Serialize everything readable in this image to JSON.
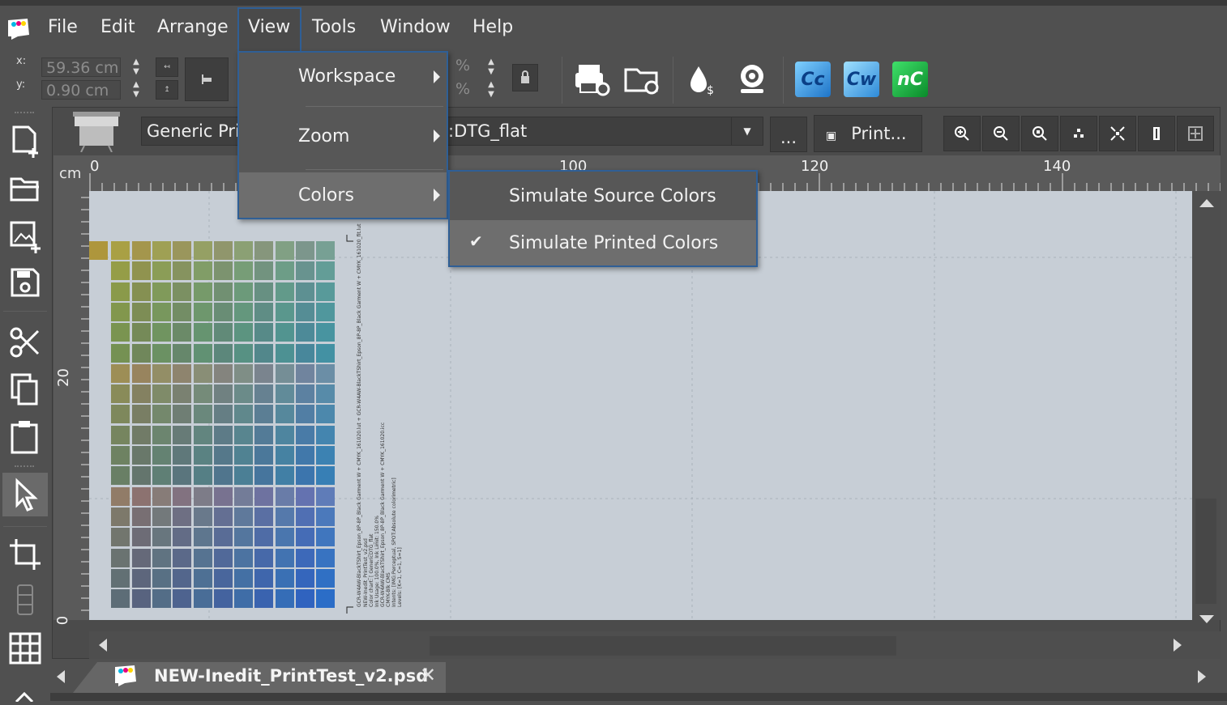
{
  "menubar": {
    "items": [
      "File",
      "Edit",
      "Arrange",
      "View",
      "Tools",
      "Window",
      "Help"
    ]
  },
  "coords": {
    "x_label": "x:",
    "y_label": "y:",
    "x_value": "59.36 cm",
    "y_value": "0.90 cm",
    "percent1": "%",
    "percent2": "%"
  },
  "toolbar": {
    "icons": [
      "print-settings-icon",
      "hotfolder-sync-icon",
      "ink-cost-icon",
      "webcam-icon",
      "cc-app-icon",
      "cw-app-icon",
      "nc-app-icon"
    ],
    "cc_label": "Cc",
    "cw_label": "Cw",
    "nc_label": "nC"
  },
  "docbar": {
    "printer": "Generic Prin",
    "profile": ":DTG_flat",
    "more_label": "...",
    "print_label": "Print..."
  },
  "ruler": {
    "unit": "cm",
    "top_labels": [
      "0",
      "100",
      "120",
      "140"
    ],
    "left_labels": [
      "20",
      "0"
    ]
  },
  "view_menu": {
    "items": [
      {
        "label": "Workspace"
      },
      {
        "label": "Zoom"
      },
      {
        "label": "Colors"
      }
    ]
  },
  "colors_submenu": {
    "items": [
      {
        "label": "Simulate Source Colors",
        "checked": false
      },
      {
        "label": "Simulate Printed Colors",
        "checked": true
      }
    ]
  },
  "document": {
    "tab_name": "NEW-Inedit_PrintTest_v2.psd",
    "info_lines": [
      "NEW-Inedit_PrintTest_v2.psd",
      "Color chart: [ GenericDTG_flat",
      "GCR-W4AW-BlackTShirt_Epson_8P-8P_Black Garment W + CMYK_161020.lut + GCR-W4AW-BlackTShirt_Epson_8P-8P_Black Garment W + CMYK_161020_fit.lut",
      "Ink Usage: 100.0%, Ink Limit: 150.0%",
      "GCR-W4AW-BlackTShirt_Epson_8P-8P_Black Garment W + CMYK_161020.icc",
      "CMYK-Blk CMS",
      "Intents: [IMG:Perceptual, SPOT:Absolute colorimetric]",
      "Levels: [K=1, C=1, S=1]"
    ]
  },
  "colors": {
    "accent": "#2f5f96",
    "bg": "#505050",
    "canvas": "#c7ced6"
  }
}
